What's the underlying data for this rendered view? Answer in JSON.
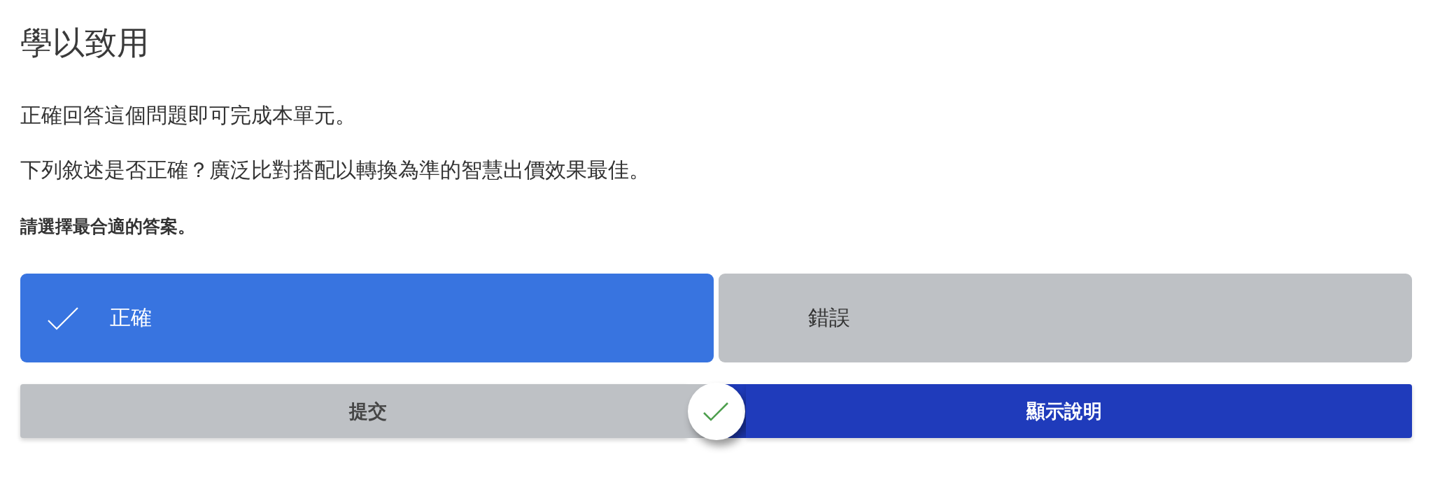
{
  "title": "學以致用",
  "intro": "正確回答這個問題即可完成本單元。",
  "question": "下列敘述是否正確？廣泛比對搭配以轉換為準的智慧出價效果最佳。",
  "instruction": "請選擇最合適的答案。",
  "options": [
    {
      "label": "正確",
      "selected": true
    },
    {
      "label": "錯誤",
      "selected": false
    }
  ],
  "actions": [
    {
      "label": "提交",
      "kind": "secondary"
    },
    {
      "label": "顯示說明",
      "kind": "primary"
    }
  ],
  "feedback": {
    "correct": true
  }
}
